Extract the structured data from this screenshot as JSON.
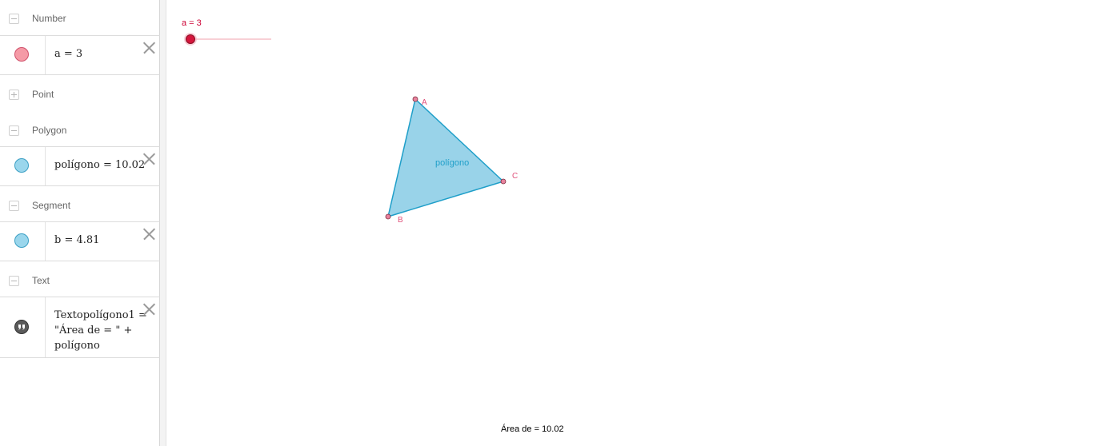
{
  "algebra": {
    "groups": {
      "number": {
        "label": "Number",
        "toggle": "collapse"
      },
      "point": {
        "label": "Point",
        "toggle": "expand"
      },
      "polygon": {
        "label": "Polygon",
        "toggle": "collapse"
      },
      "segment": {
        "label": "Segment",
        "toggle": "collapse"
      },
      "text": {
        "label": "Text",
        "toggle": "collapse"
      }
    },
    "items": {
      "a": {
        "formula": "a = 3",
        "color": "#f28b8b"
      },
      "poly": {
        "formula": "polígono = 10.02",
        "color": "#96d4ea"
      },
      "b": {
        "formula": "b = 4.81",
        "color": "#96d4ea"
      },
      "text": {
        "line1": "Textopolígono1 =",
        "line2": "\"Área de = \" +",
        "line3": "polígono",
        "icon": "quote-icon"
      }
    }
  },
  "graphics": {
    "slider": {
      "label": "a = 3",
      "value": 3,
      "color": "#cc0033"
    },
    "points": {
      "A": "A",
      "B": "B",
      "C": "C"
    },
    "polygon_label": "polígono",
    "polygon_fill": "#99d3e9",
    "polygon_stroke": "#1f9fc9",
    "point_color": "#e85a8a",
    "area_text": "Área de  = 10.02"
  }
}
